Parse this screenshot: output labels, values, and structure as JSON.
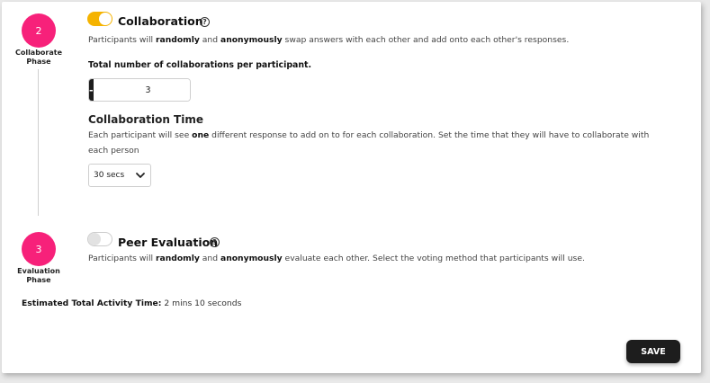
{
  "phases": [
    {
      "number": "2",
      "label": "Collaborate Phase",
      "enabled": true,
      "title": "Collaboration",
      "help_icon": "question-circle-icon",
      "description": {
        "p1": "Participants will ",
        "b1": "randomly",
        "p2": " and ",
        "b2": "anonymously",
        "p3": " swap answers with each other and add onto each other's responses."
      },
      "collab_count_label": "Total number of collaborations per participant.",
      "stepper": {
        "minus": "-",
        "value": "3",
        "plus": "+"
      },
      "time_title": "Collaboration Time",
      "time_description": {
        "p1": "Each participant will see ",
        "b1": "one",
        "p2": " different response to add on to for each collaboration. Set the time that they will have to collaborate with",
        "line2": "each person"
      },
      "time_select": "30 secs"
    },
    {
      "number": "3",
      "label": "Evaluation Phase",
      "enabled": false,
      "title": "Peer Evaluation",
      "help_icon": "question-circle-icon",
      "description": {
        "p1": "Participants will ",
        "b1": "randomly",
        "p2": " and ",
        "b2": "anonymously",
        "p3": " evaluate each other. Select the voting method that participants will use."
      }
    }
  ],
  "estimate": {
    "label": "Estimated Total Activity Time:",
    "value": " 2 mins 10 seconds"
  },
  "save_label": "SAVE",
  "colors": {
    "accent_pink": "#f7217a",
    "toggle_on": "#f5b300",
    "button_dark": "#1d1d1d"
  }
}
